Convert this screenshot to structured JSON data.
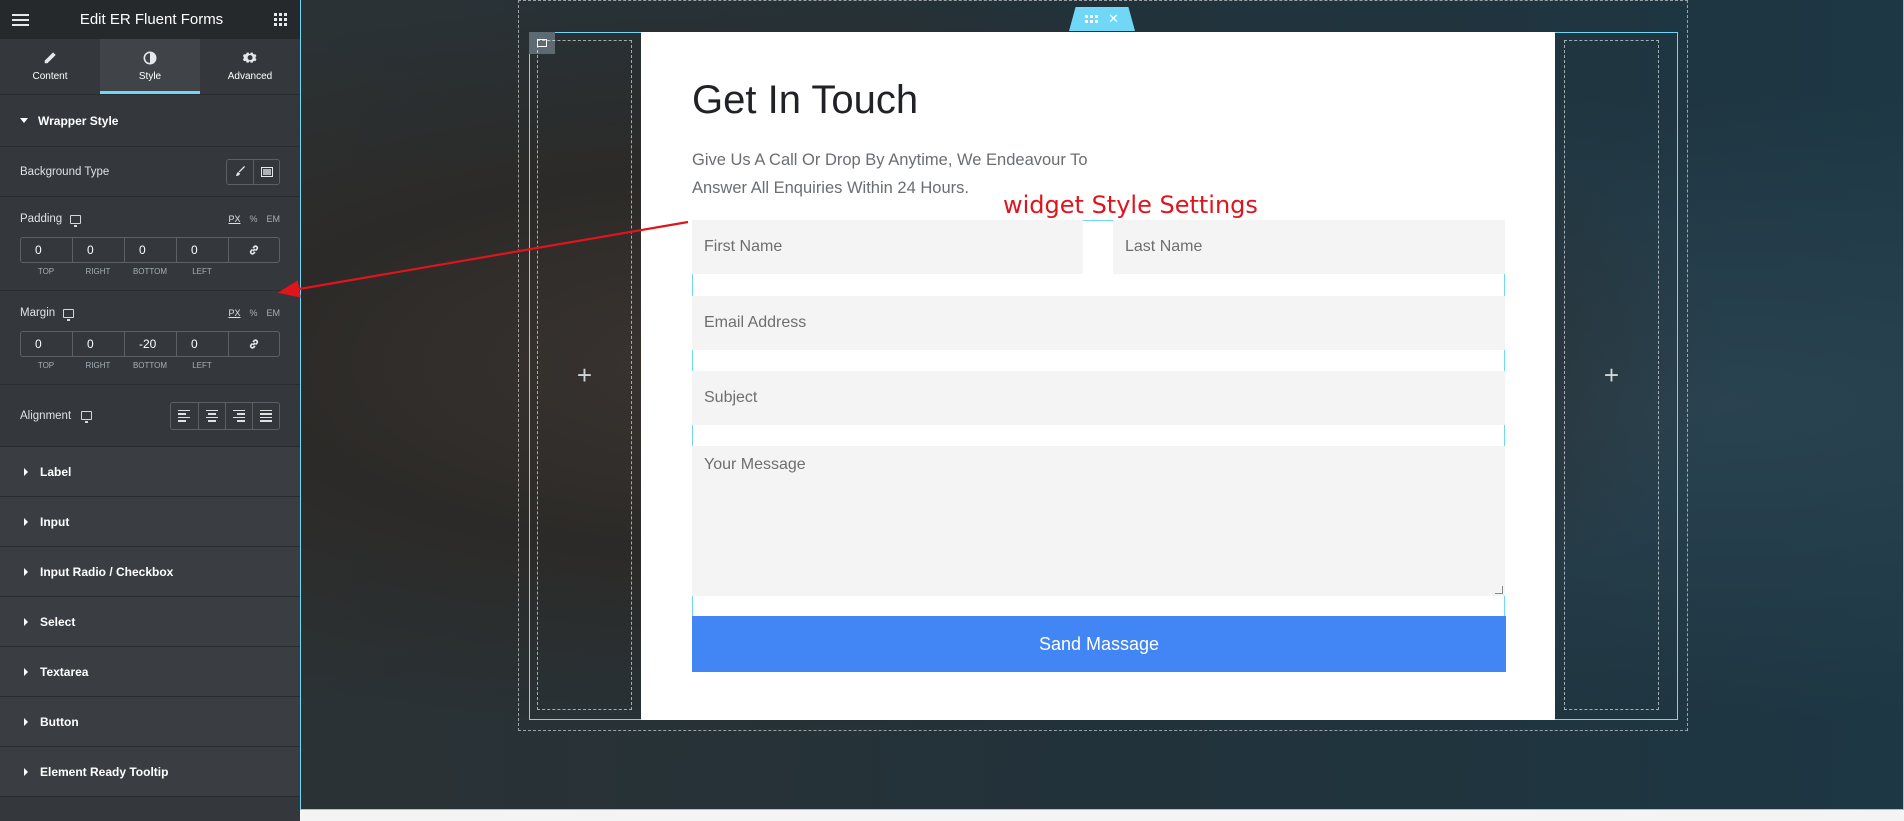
{
  "header": {
    "title": "Edit ER Fluent Forms"
  },
  "tabs": [
    {
      "label": "Content",
      "icon": "pencil-icon"
    },
    {
      "label": "Style",
      "icon": "half-circle-icon"
    },
    {
      "label": "Advanced",
      "icon": "gear-icon"
    }
  ],
  "wrapper": {
    "title": "Wrapper Style",
    "background_type_label": "Background Type",
    "padding": {
      "label": "Padding",
      "values": [
        "0",
        "0",
        "0",
        "0"
      ]
    },
    "margin": {
      "label": "Margin",
      "values": [
        "0",
        "0",
        "-20",
        "0"
      ]
    },
    "units": [
      "PX",
      "%",
      "EM"
    ],
    "side_labels": [
      "TOP",
      "RIGHT",
      "BOTTOM",
      "LEFT"
    ],
    "alignment_label": "Alignment"
  },
  "sections": [
    "Label",
    "Input",
    "Input Radio / Checkbox",
    "Select",
    "Textarea",
    "Button",
    "Element Ready Tooltip"
  ],
  "form": {
    "heading": "Get In Touch",
    "subtitle": "Give Us A Call Or Drop By Anytime, We Endeavour To Answer All Enquiries Within 24 Hours.",
    "first_name_placeholder": "First Name",
    "last_name_placeholder": "Last Name",
    "email_placeholder": "Email Address",
    "subject_placeholder": "Subject",
    "message_placeholder": "Your Message",
    "submit_label": "Sand Massage"
  },
  "annotation": {
    "text": "widget Style Settings",
    "color": "#e0141c"
  },
  "colors": {
    "accent": "#71d7f7",
    "button": "#4285f4",
    "sidebar": "#34383c"
  }
}
